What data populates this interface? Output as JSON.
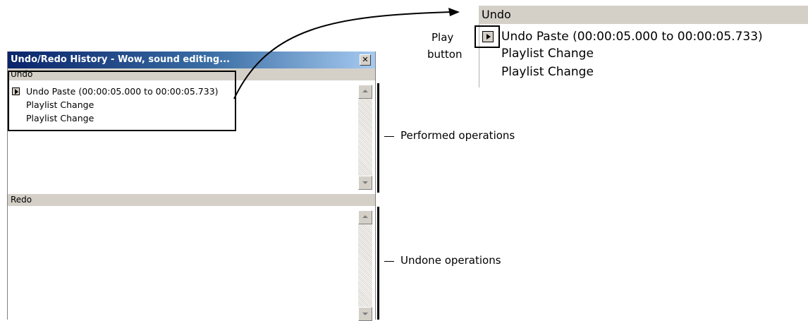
{
  "window": {
    "title": "Undo/Redo History - Wow, sound editing...",
    "close_glyph": "✕"
  },
  "undo": {
    "header": "Undo",
    "items": [
      "Undo Paste (00:00:05.000 to 00:00:05.733)",
      "Playlist Change",
      "Playlist Change"
    ]
  },
  "redo": {
    "header": "Redo",
    "items": []
  },
  "callouts": {
    "performed": "Performed operations",
    "undone": "Undone operations"
  },
  "zoom": {
    "header": "Undo",
    "items": [
      "Undo Paste (00:00:05.000 to 00:00:05.733)",
      "Playlist Change",
      "Playlist Change"
    ],
    "play_label_line1": "Play",
    "play_label_line2": "button"
  },
  "icons": {
    "play": "play-icon",
    "close": "close-icon",
    "scroll_up": "arrow-up-icon",
    "scroll_down": "arrow-down-icon"
  }
}
